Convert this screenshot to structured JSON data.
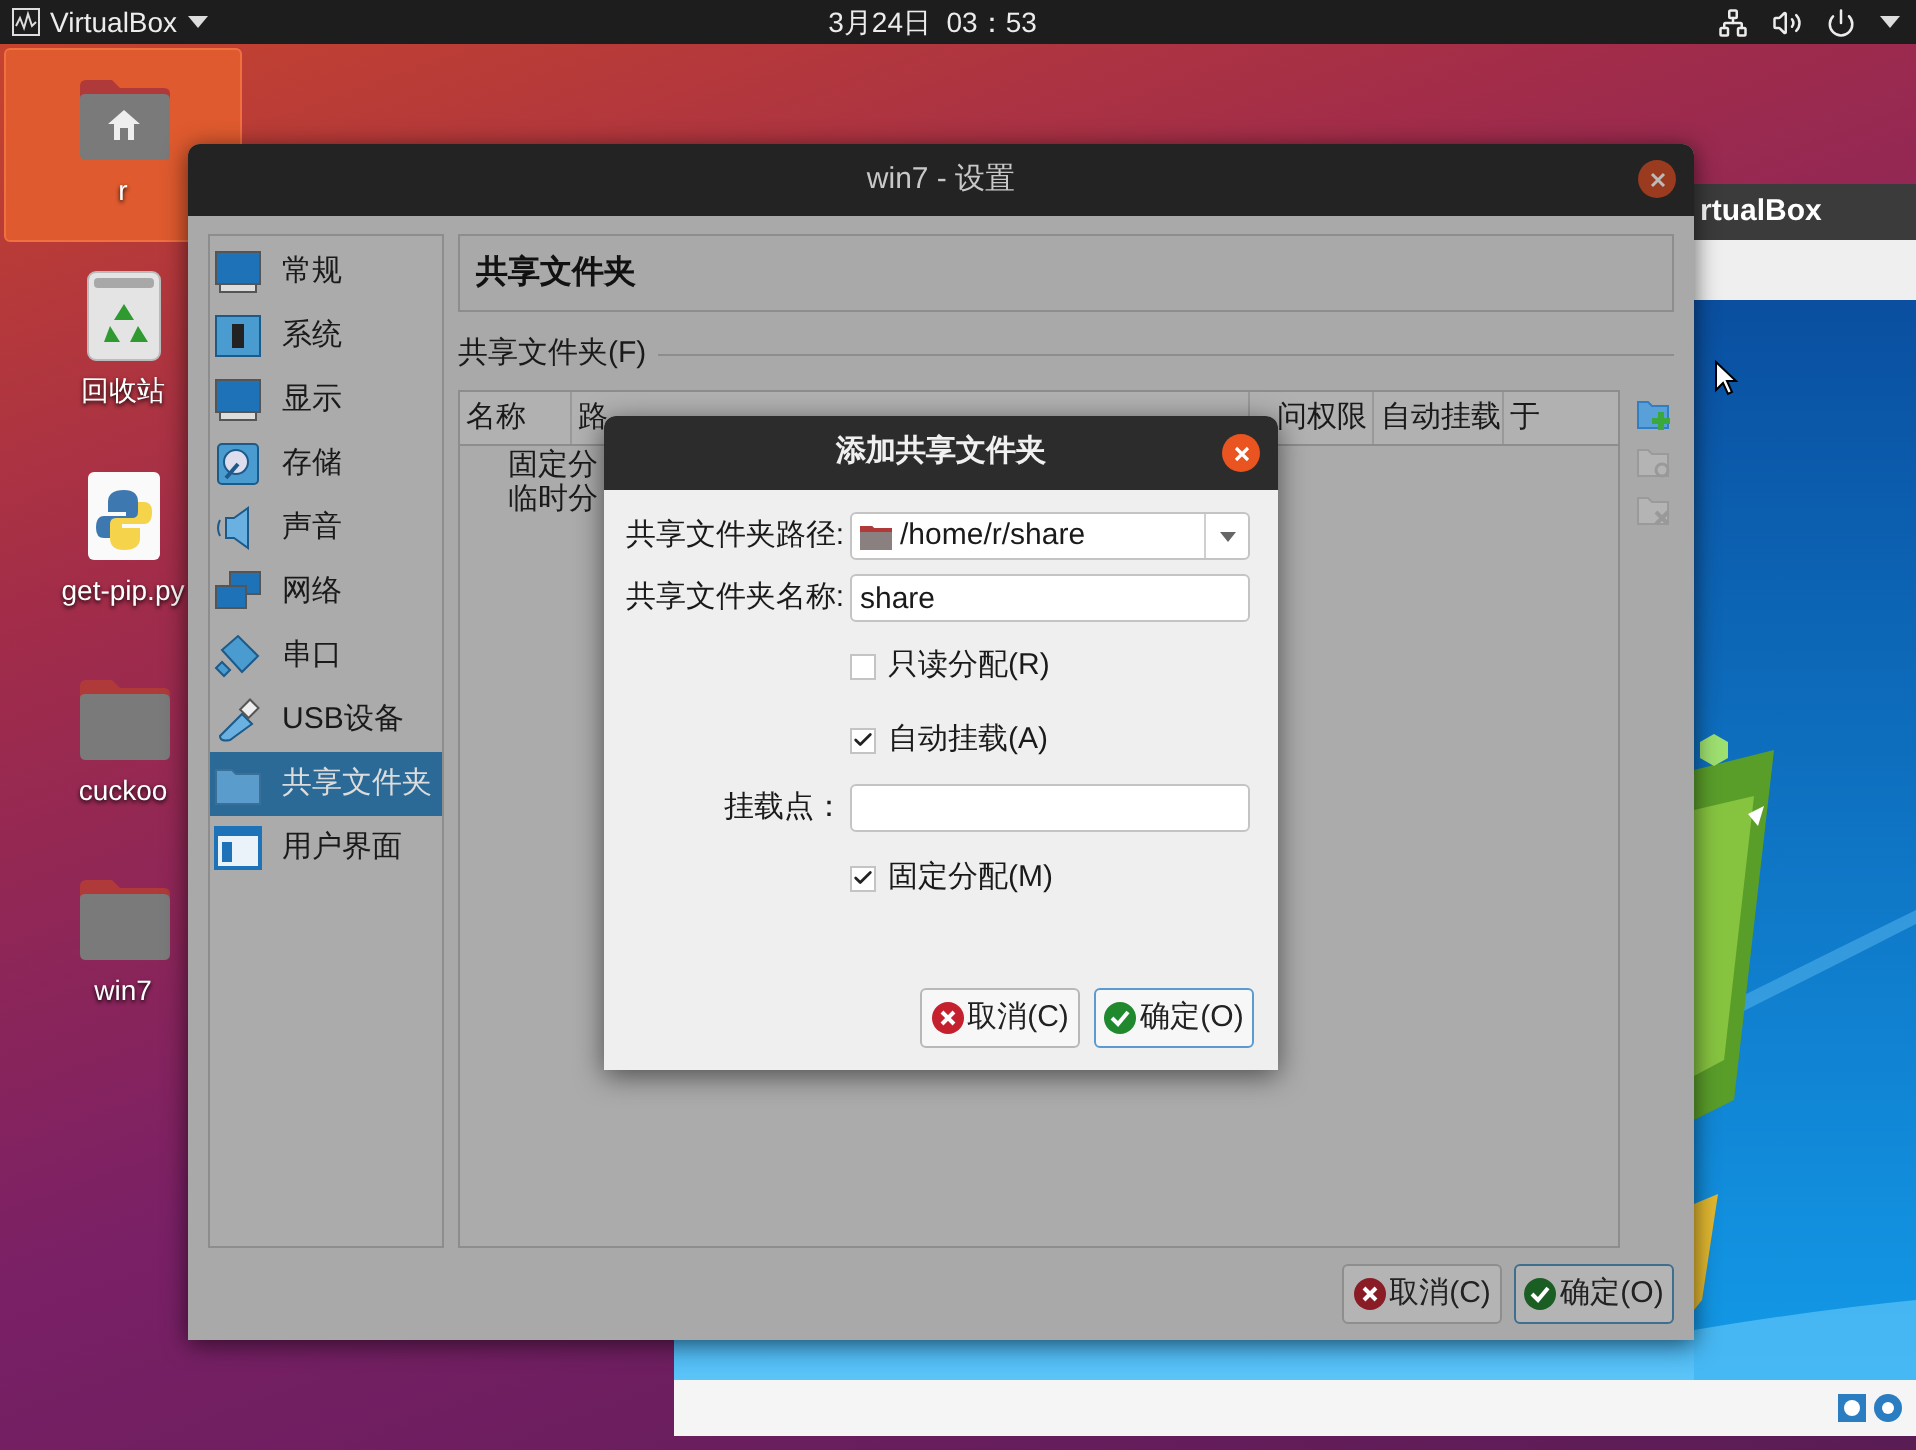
{
  "top_bar": {
    "app_menu": "VirtualBox",
    "clock": "3月24日  03：53"
  },
  "desktop_icons": [
    {
      "label": "r",
      "kind": "home",
      "selected": true
    },
    {
      "label": "回收站",
      "kind": "trash",
      "selected": false
    },
    {
      "label": "get-pip.py",
      "kind": "python",
      "selected": false
    },
    {
      "label": "cuckoo",
      "kind": "folder",
      "selected": false
    },
    {
      "label": "win7",
      "kind": "folder",
      "selected": false
    }
  ],
  "vm_window": {
    "title": "rtualBox"
  },
  "settings_window": {
    "title": "win7 - 设置",
    "sidebar": [
      {
        "label": "常规",
        "kind": "general",
        "selected": false
      },
      {
        "label": "系统",
        "kind": "system",
        "selected": false
      },
      {
        "label": "显示",
        "kind": "display",
        "selected": false
      },
      {
        "label": "存储",
        "kind": "storage",
        "selected": false
      },
      {
        "label": "声音",
        "kind": "audio",
        "selected": false
      },
      {
        "label": "网络",
        "kind": "network",
        "selected": false
      },
      {
        "label": "串口",
        "kind": "serial",
        "selected": false
      },
      {
        "label": "USB设备",
        "kind": "usb",
        "selected": false
      },
      {
        "label": "共享文件夹",
        "kind": "shared",
        "selected": true
      },
      {
        "label": "用户界面",
        "kind": "ui",
        "selected": false
      }
    ],
    "page_title": "共享文件夹",
    "group_label": "共享文件夹(F)",
    "table": {
      "columns": [
        "名称",
        "路",
        "问权限",
        "自动挂载",
        "于"
      ],
      "rows": [
        {
          "name": "固定分"
        },
        {
          "name": "临时分"
        }
      ]
    },
    "tools": [
      {
        "kind": "add",
        "disabled": false
      },
      {
        "kind": "edit",
        "disabled": true
      },
      {
        "kind": "remove",
        "disabled": true
      }
    ],
    "buttons": [
      {
        "kind": "cancel",
        "label": "取消(C)",
        "default": false
      },
      {
        "kind": "ok",
        "label": "确定(O)",
        "default": true
      }
    ]
  },
  "dialog": {
    "title": "添加共享文件夹",
    "rows": [
      {
        "kind": "combo",
        "label": "共享文件夹路径:",
        "value": "/home/r/share"
      },
      {
        "kind": "text",
        "label": "共享文件夹名称:",
        "value": "share"
      },
      {
        "kind": "checkbox",
        "label": "只读分配(R)",
        "checked": false
      },
      {
        "kind": "checkbox",
        "label": "自动挂载(A)",
        "checked": true
      },
      {
        "kind": "text",
        "label": "挂载点："
      },
      {
        "kind": "checkbox",
        "label": "固定分配(M)",
        "checked": true
      }
    ],
    "buttons": [
      {
        "kind": "cancel",
        "label": "取消(C)",
        "default": false
      },
      {
        "kind": "ok",
        "label": "确定(O)",
        "default": true
      }
    ]
  }
}
